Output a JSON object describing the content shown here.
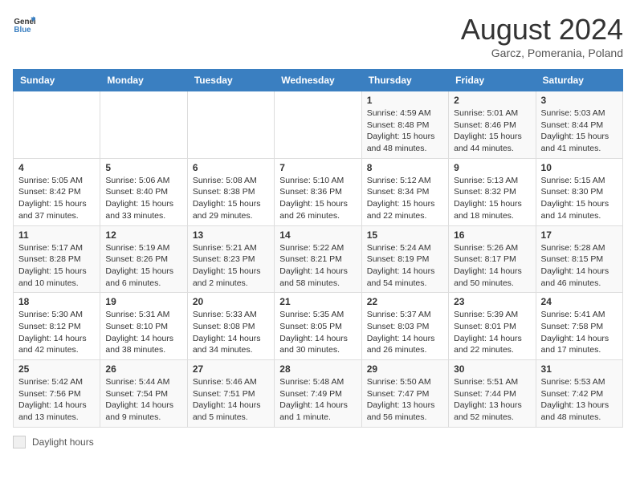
{
  "header": {
    "logo_line1": "General",
    "logo_line2": "Blue",
    "month": "August 2024",
    "location": "Garcz, Pomerania, Poland"
  },
  "days_of_week": [
    "Sunday",
    "Monday",
    "Tuesday",
    "Wednesday",
    "Thursday",
    "Friday",
    "Saturday"
  ],
  "weeks": [
    [
      {
        "day": "",
        "info": ""
      },
      {
        "day": "",
        "info": ""
      },
      {
        "day": "",
        "info": ""
      },
      {
        "day": "",
        "info": ""
      },
      {
        "day": "1",
        "info": "Sunrise: 4:59 AM\nSunset: 8:48 PM\nDaylight: 15 hours\nand 48 minutes."
      },
      {
        "day": "2",
        "info": "Sunrise: 5:01 AM\nSunset: 8:46 PM\nDaylight: 15 hours\nand 44 minutes."
      },
      {
        "day": "3",
        "info": "Sunrise: 5:03 AM\nSunset: 8:44 PM\nDaylight: 15 hours\nand 41 minutes."
      }
    ],
    [
      {
        "day": "4",
        "info": "Sunrise: 5:05 AM\nSunset: 8:42 PM\nDaylight: 15 hours\nand 37 minutes."
      },
      {
        "day": "5",
        "info": "Sunrise: 5:06 AM\nSunset: 8:40 PM\nDaylight: 15 hours\nand 33 minutes."
      },
      {
        "day": "6",
        "info": "Sunrise: 5:08 AM\nSunset: 8:38 PM\nDaylight: 15 hours\nand 29 minutes."
      },
      {
        "day": "7",
        "info": "Sunrise: 5:10 AM\nSunset: 8:36 PM\nDaylight: 15 hours\nand 26 minutes."
      },
      {
        "day": "8",
        "info": "Sunrise: 5:12 AM\nSunset: 8:34 PM\nDaylight: 15 hours\nand 22 minutes."
      },
      {
        "day": "9",
        "info": "Sunrise: 5:13 AM\nSunset: 8:32 PM\nDaylight: 15 hours\nand 18 minutes."
      },
      {
        "day": "10",
        "info": "Sunrise: 5:15 AM\nSunset: 8:30 PM\nDaylight: 15 hours\nand 14 minutes."
      }
    ],
    [
      {
        "day": "11",
        "info": "Sunrise: 5:17 AM\nSunset: 8:28 PM\nDaylight: 15 hours\nand 10 minutes."
      },
      {
        "day": "12",
        "info": "Sunrise: 5:19 AM\nSunset: 8:26 PM\nDaylight: 15 hours\nand 6 minutes."
      },
      {
        "day": "13",
        "info": "Sunrise: 5:21 AM\nSunset: 8:23 PM\nDaylight: 15 hours\nand 2 minutes."
      },
      {
        "day": "14",
        "info": "Sunrise: 5:22 AM\nSunset: 8:21 PM\nDaylight: 14 hours\nand 58 minutes."
      },
      {
        "day": "15",
        "info": "Sunrise: 5:24 AM\nSunset: 8:19 PM\nDaylight: 14 hours\nand 54 minutes."
      },
      {
        "day": "16",
        "info": "Sunrise: 5:26 AM\nSunset: 8:17 PM\nDaylight: 14 hours\nand 50 minutes."
      },
      {
        "day": "17",
        "info": "Sunrise: 5:28 AM\nSunset: 8:15 PM\nDaylight: 14 hours\nand 46 minutes."
      }
    ],
    [
      {
        "day": "18",
        "info": "Sunrise: 5:30 AM\nSunset: 8:12 PM\nDaylight: 14 hours\nand 42 minutes."
      },
      {
        "day": "19",
        "info": "Sunrise: 5:31 AM\nSunset: 8:10 PM\nDaylight: 14 hours\nand 38 minutes."
      },
      {
        "day": "20",
        "info": "Sunrise: 5:33 AM\nSunset: 8:08 PM\nDaylight: 14 hours\nand 34 minutes."
      },
      {
        "day": "21",
        "info": "Sunrise: 5:35 AM\nSunset: 8:05 PM\nDaylight: 14 hours\nand 30 minutes."
      },
      {
        "day": "22",
        "info": "Sunrise: 5:37 AM\nSunset: 8:03 PM\nDaylight: 14 hours\nand 26 minutes."
      },
      {
        "day": "23",
        "info": "Sunrise: 5:39 AM\nSunset: 8:01 PM\nDaylight: 14 hours\nand 22 minutes."
      },
      {
        "day": "24",
        "info": "Sunrise: 5:41 AM\nSunset: 7:58 PM\nDaylight: 14 hours\nand 17 minutes."
      }
    ],
    [
      {
        "day": "25",
        "info": "Sunrise: 5:42 AM\nSunset: 7:56 PM\nDaylight: 14 hours\nand 13 minutes."
      },
      {
        "day": "26",
        "info": "Sunrise: 5:44 AM\nSunset: 7:54 PM\nDaylight: 14 hours\nand 9 minutes."
      },
      {
        "day": "27",
        "info": "Sunrise: 5:46 AM\nSunset: 7:51 PM\nDaylight: 14 hours\nand 5 minutes."
      },
      {
        "day": "28",
        "info": "Sunrise: 5:48 AM\nSunset: 7:49 PM\nDaylight: 14 hours\nand 1 minute."
      },
      {
        "day": "29",
        "info": "Sunrise: 5:50 AM\nSunset: 7:47 PM\nDaylight: 13 hours\nand 56 minutes."
      },
      {
        "day": "30",
        "info": "Sunrise: 5:51 AM\nSunset: 7:44 PM\nDaylight: 13 hours\nand 52 minutes."
      },
      {
        "day": "31",
        "info": "Sunrise: 5:53 AM\nSunset: 7:42 PM\nDaylight: 13 hours\nand 48 minutes."
      }
    ]
  ],
  "legend": {
    "label": "Daylight hours"
  }
}
